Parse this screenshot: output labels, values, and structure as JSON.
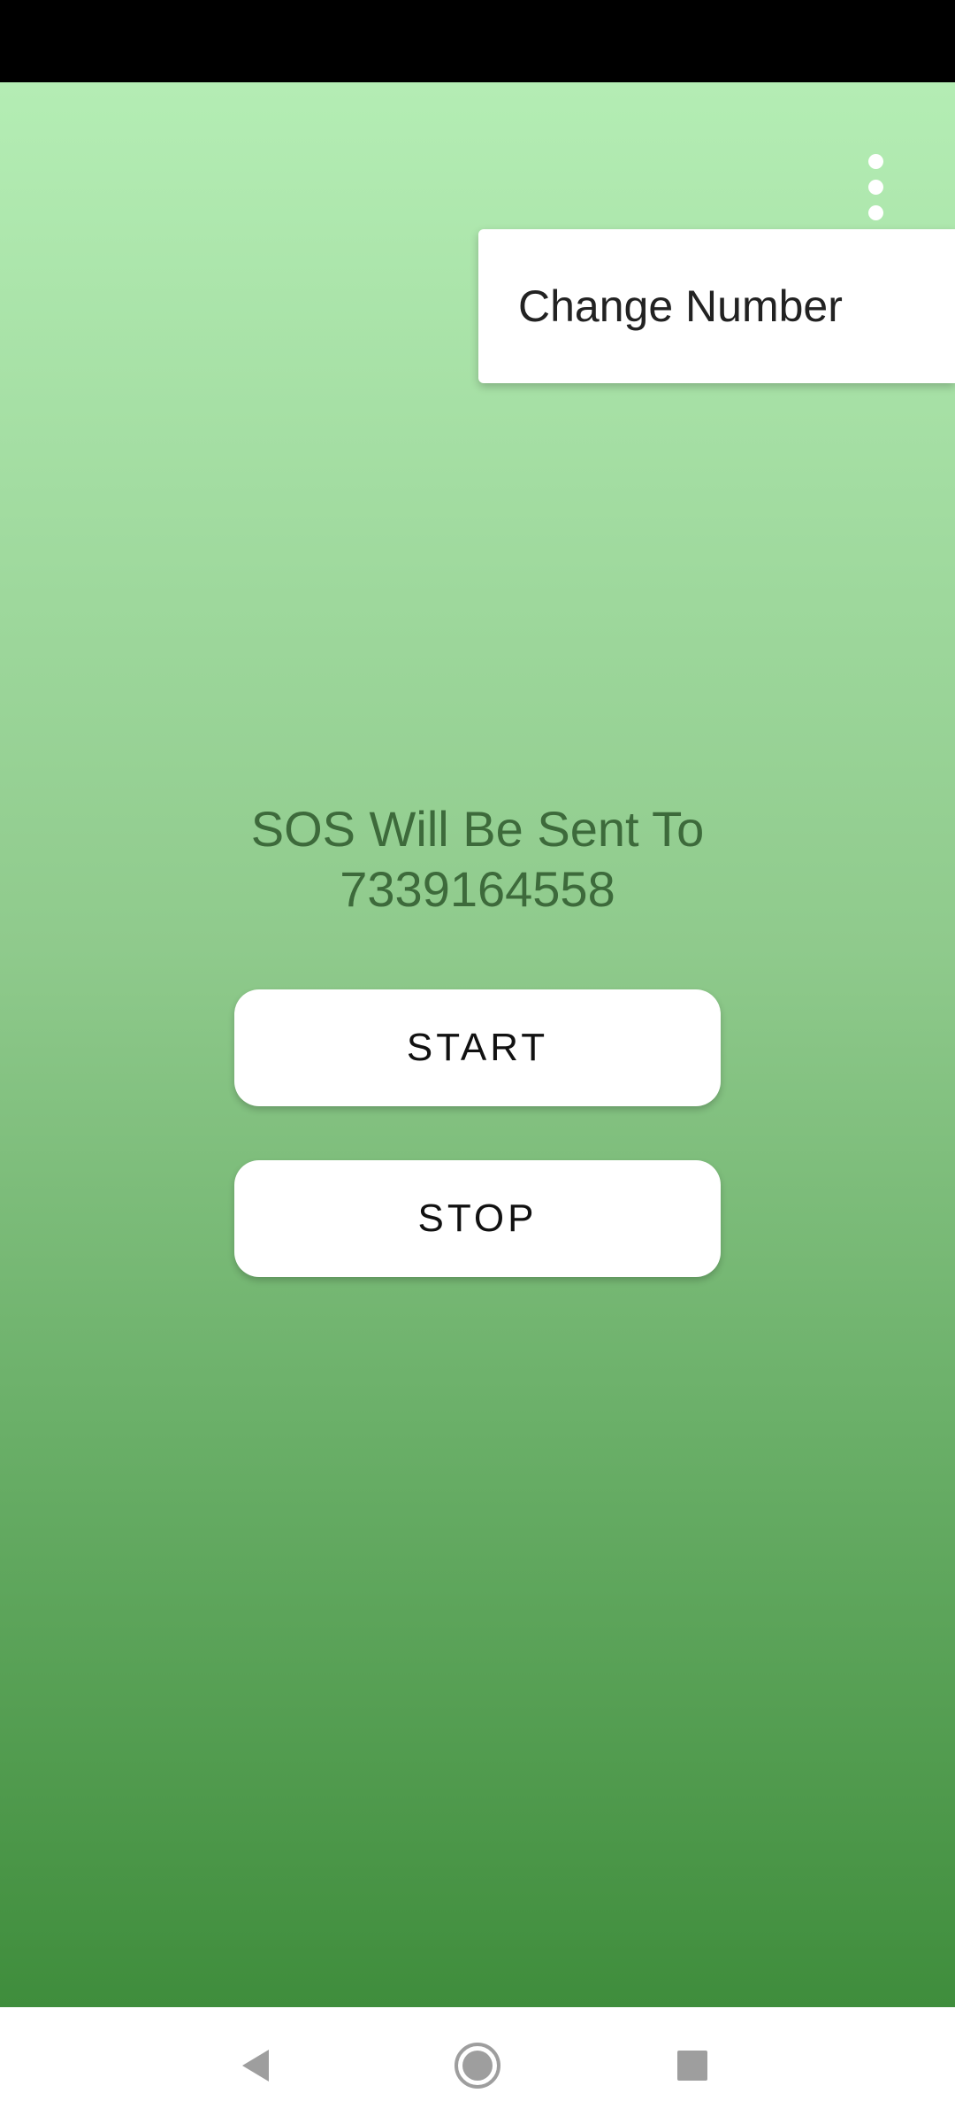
{
  "menu": {
    "items": [
      {
        "label": "Change Number"
      }
    ]
  },
  "main": {
    "sos_line1": "SOS Will Be Sent To",
    "sos_number": "7339164558",
    "start_label": "START",
    "stop_label": "STOP"
  },
  "icons": {
    "overflow": "more-vert-icon",
    "back": "back-triangle-icon",
    "home": "home-circle-icon",
    "recents": "recents-square-icon"
  },
  "colors": {
    "gradient_top": "#b4edb4",
    "gradient_bottom": "#3f8d3c",
    "sos_text": "#3d6a3b",
    "nav_icon": "#9e9e9e"
  }
}
